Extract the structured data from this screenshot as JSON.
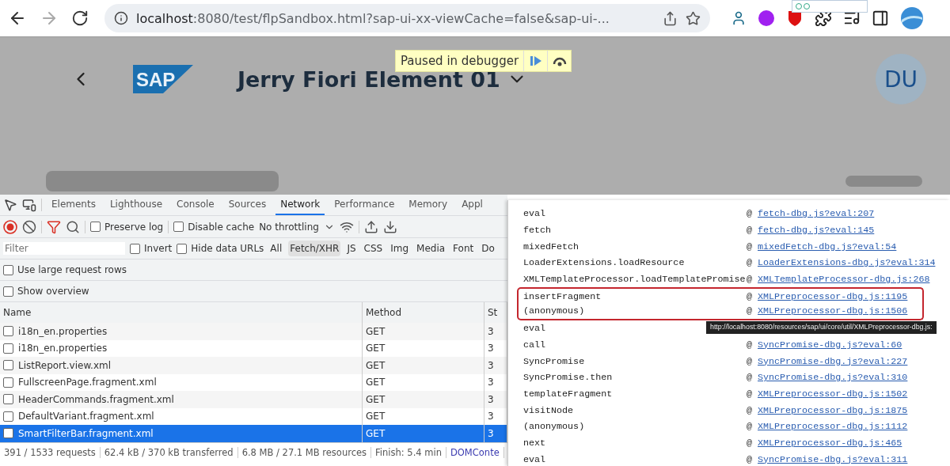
{
  "browser": {
    "url_host": "localhost",
    "url_rest": ":8080/test/flpSandbox.html?sap-ui-xx-viewCache=false&sap-ui-..."
  },
  "app": {
    "logo_text": "SAP",
    "title": "Jerry Fiori Element 01",
    "avatar": "DU",
    "debugger_label": "Paused in debugger"
  },
  "devtools": {
    "tabs": [
      {
        "label": "Elements",
        "selected": false
      },
      {
        "label": "Lighthouse",
        "selected": false
      },
      {
        "label": "Console",
        "selected": false
      },
      {
        "label": "Sources",
        "selected": false
      },
      {
        "label": "Network",
        "selected": true
      },
      {
        "label": "Performance",
        "selected": false
      },
      {
        "label": "Memory",
        "selected": false
      },
      {
        "label": "Appl",
        "selected": false
      }
    ],
    "recording": true,
    "preserve_log": {
      "label": "Preserve log",
      "checked": false
    },
    "disable_cache": {
      "label": "Disable cache",
      "checked": false
    },
    "throttling": "No throttling",
    "filter": {
      "placeholder": "Filter"
    },
    "invert": {
      "label": "Invert",
      "checked": false
    },
    "hide_data_urls": {
      "label": "Hide data URLs",
      "checked": false
    },
    "types": [
      {
        "label": "All",
        "selected": false
      },
      {
        "label": "Fetch/XHR",
        "selected": true
      },
      {
        "label": "JS",
        "selected": false
      },
      {
        "label": "CSS",
        "selected": false
      },
      {
        "label": "Img",
        "selected": false
      },
      {
        "label": "Media",
        "selected": false
      },
      {
        "label": "Font",
        "selected": false
      },
      {
        "label": "Do",
        "selected": false
      }
    ],
    "options": [
      {
        "label": "Use large request rows",
        "checked": false
      },
      {
        "label": "Show overview",
        "checked": false
      }
    ],
    "columns": [
      "Name",
      "Method",
      "St"
    ],
    "rows": [
      {
        "name": "i18n_en.properties",
        "method": "GET",
        "status": "3",
        "selected": false
      },
      {
        "name": "i18n_en.properties",
        "method": "GET",
        "status": "3",
        "selected": false
      },
      {
        "name": "ListReport.view.xml",
        "method": "GET",
        "status": "3",
        "selected": false
      },
      {
        "name": "FullscreenPage.fragment.xml",
        "method": "GET",
        "status": "3",
        "selected": false
      },
      {
        "name": "HeaderCommands.fragment.xml",
        "method": "GET",
        "status": "3",
        "selected": false
      },
      {
        "name": "DefaultVariant.fragment.xml",
        "method": "GET",
        "status": "3",
        "selected": false
      },
      {
        "name": "SmartFilterBar.fragment.xml",
        "method": "GET",
        "status": "3",
        "selected": true
      }
    ],
    "summary": [
      {
        "text": "391 / 1533 requests",
        "kind": "text"
      },
      {
        "text": "62.4 kB / 370 kB transferred",
        "kind": "text"
      },
      {
        "text": "6.8 MB / 27.1 MB resources",
        "kind": "text"
      },
      {
        "text": "Finish: 5.4 min",
        "kind": "text"
      },
      {
        "text": "DOMConte",
        "kind": "link"
      }
    ]
  },
  "call_stack": {
    "frames": [
      {
        "function": "eval",
        "at": "@",
        "location": "fetch-dbg.js?eval:207",
        "highlighted": false
      },
      {
        "function": "fetch",
        "at": "@",
        "location": "fetch-dbg.js?eval:145",
        "highlighted": false
      },
      {
        "function": "mixedFetch",
        "at": "@",
        "location": "mixedFetch-dbg.js?eval:54",
        "highlighted": false
      },
      {
        "function": "LoaderExtensions.loadResource",
        "at": "@",
        "location": "LoaderExtensions-dbg.js?eval:314",
        "highlighted": false
      },
      {
        "function": "XMLTemplateProcessor.loadTemplatePromise",
        "at": "@",
        "location": "XMLTemplateProcessor-dbg.js:268",
        "highlighted": false
      },
      {
        "function": "insertFragment",
        "at": "@",
        "location": "XMLPreprocessor-dbg.js:1195",
        "highlighted": true
      },
      {
        "function": "(anonymous)",
        "at": "@",
        "location": "XMLPreprocessor-dbg.js:1506",
        "highlighted": true
      },
      {
        "function": "eval",
        "highlighted": false
      },
      {
        "function": "call",
        "at": "@",
        "location": "SyncPromise-dbg.js?eval:60",
        "highlighted": false
      },
      {
        "function": "SyncPromise",
        "at": "@",
        "location": "SyncPromise-dbg.js?eval:227",
        "highlighted": false
      },
      {
        "function": "SyncPromise.then",
        "at": "@",
        "location": "SyncPromise-dbg.js?eval:310",
        "highlighted": false
      },
      {
        "function": "templateFragment",
        "at": "@",
        "location": "XMLPreprocessor-dbg.js:1502",
        "highlighted": false
      },
      {
        "function": "visitNode",
        "at": "@",
        "location": "XMLPreprocessor-dbg.js:1875",
        "highlighted": false
      },
      {
        "function": "(anonymous)",
        "at": "@",
        "location": "XMLPreprocessor-dbg.js:1112",
        "highlighted": false
      },
      {
        "function": "next",
        "at": "@",
        "location": "XMLPreprocessor-dbg.js:465",
        "highlighted": false
      },
      {
        "function": "eval",
        "at": "@",
        "location": "SyncPromise-dbg.js?eval:311",
        "highlighted": false
      }
    ],
    "tooltip": "http://localhost:8080/resources/sap/ui/core/util/XMLPreprocessor-dbg.js:"
  }
}
